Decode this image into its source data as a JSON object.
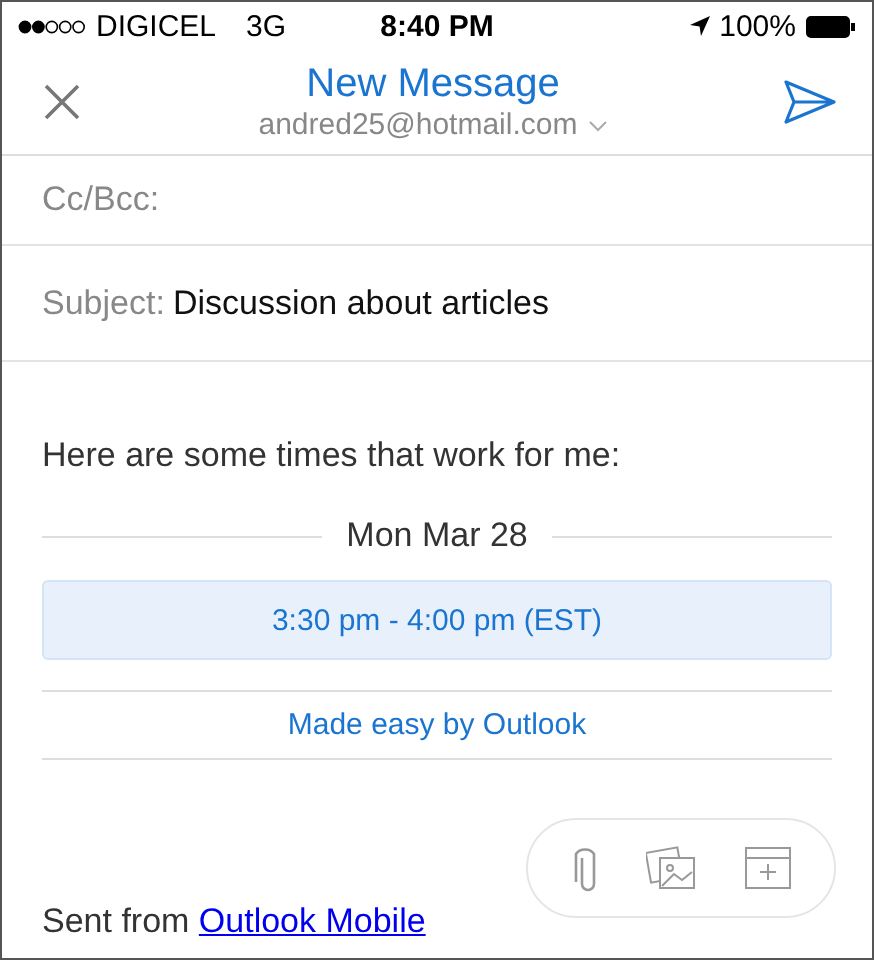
{
  "status_bar": {
    "carrier": "DIGICEL",
    "network": "3G",
    "time": "8:40 PM",
    "battery": "100%"
  },
  "header": {
    "title": "New Message",
    "account": "andred25@hotmail.com"
  },
  "cc_field": {
    "label": "Cc/Bcc:"
  },
  "subject_field": {
    "label": "Subject:",
    "value": "Discussion about articles"
  },
  "body": {
    "intro": "Here are some times that work for me:",
    "date": "Mon Mar 28",
    "slot": "3:30 pm - 4:00 pm (EST)",
    "footer_link": "Made easy by Outlook",
    "signature": "Sent from",
    "signature_link": "Outlook Mobile"
  }
}
